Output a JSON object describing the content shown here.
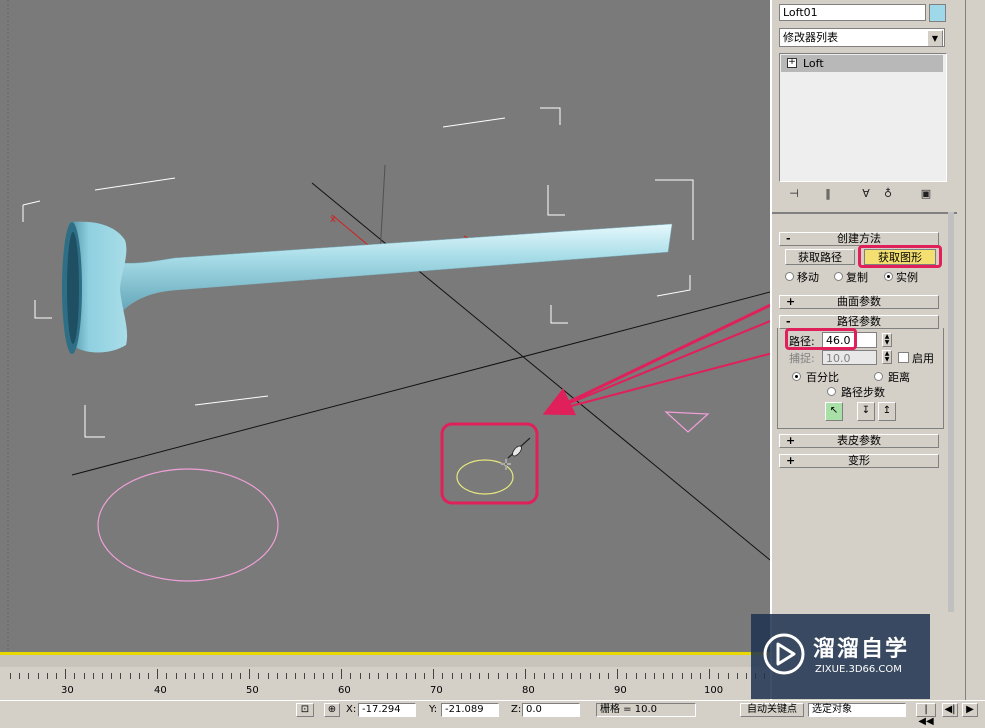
{
  "object_name": "Loft01",
  "object_color": "#9fd8e8",
  "modifier_list": {
    "placeholder": "修改器列表"
  },
  "stack": {
    "items": [
      {
        "label": "Loft",
        "expand": "+"
      }
    ]
  },
  "rollouts": {
    "creation_method": {
      "toggle": "-",
      "title": "创建方法"
    },
    "get_path": "获取路径",
    "get_shape": "获取图形",
    "move": "移动",
    "copy": "复制",
    "instance": "实例",
    "surface_params": {
      "toggle": "+",
      "title": "曲面参数"
    },
    "path_params": {
      "toggle": "-",
      "title": "路径参数"
    },
    "path_label": "路径:",
    "path_value": "46.0",
    "snap_label": "捕捉:",
    "snap_value": "10.0",
    "enable_label": "启用",
    "percentage": "百分比",
    "distance": "距离",
    "path_steps": "路径步数",
    "skin_params": {
      "toggle": "+",
      "title": "表皮参数"
    },
    "deformation": {
      "toggle": "+",
      "title": "变形"
    }
  },
  "ruler": {
    "labels": [
      "30",
      "40",
      "50",
      "60",
      "70",
      "80",
      "90",
      "100"
    ]
  },
  "status": {
    "x_label": "X:",
    "x_value": "-17.294",
    "y_label": "Y:",
    "y_value": "-21.089",
    "z_label": "Z:",
    "z_value": "0.0",
    "grid": "栅格 = 10.0",
    "auto_key": "自动关键点",
    "set_key_filter": "选定对象"
  },
  "watermark": {
    "brand": "溜溜自学",
    "url": "ZIXUE.3D66.COM"
  },
  "colors": {
    "viewport": "#7a7a7a",
    "highlight": "#e0205a",
    "loft": "#a8dde8",
    "shape_circle": "#f0a0d8",
    "selected_shape": "#e8e880"
  }
}
